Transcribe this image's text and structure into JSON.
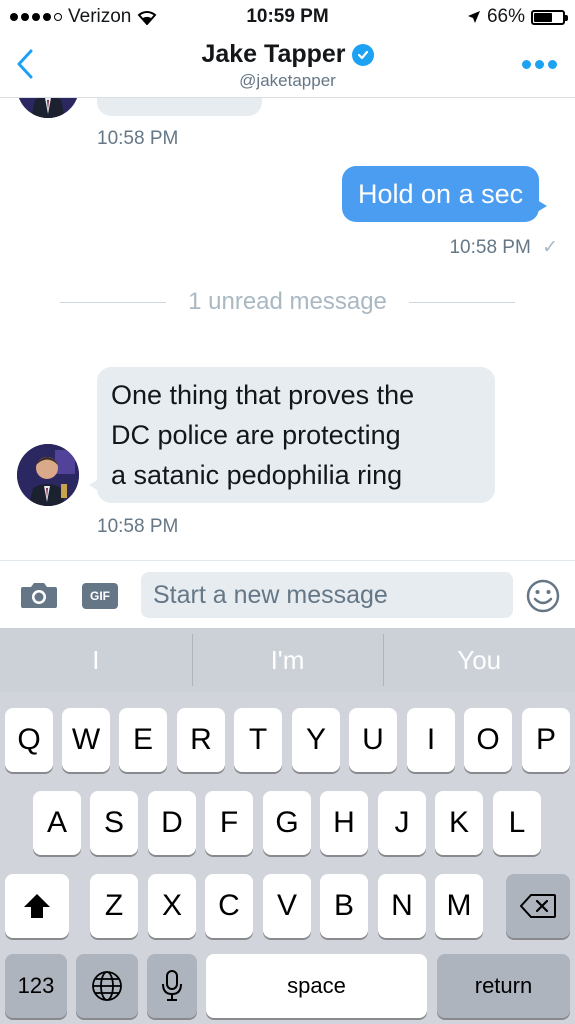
{
  "status_bar": {
    "carrier": "Verizon",
    "time": "10:59 PM",
    "battery": "66%",
    "battery_level": 0.66
  },
  "header": {
    "name": "Jake Tapper",
    "handle": "@jaketapper"
  },
  "conversation": {
    "first_time": "10:58 PM",
    "outgoing_text": "Hold on a sec",
    "outgoing_time": "10:58 PM",
    "read_mark": "✓",
    "unread_label": "1 unread message",
    "incoming_lines": [
      "One thing that proves the",
      "DC police are protecting",
      "a satanic pedophilia ring"
    ],
    "incoming_time": "10:58 PM"
  },
  "composer": {
    "gif_label": "GIF",
    "placeholder": "Start a new message"
  },
  "predictive": [
    "I",
    "I'm",
    "You"
  ],
  "keyboard": {
    "row1": [
      "Q",
      "W",
      "E",
      "R",
      "T",
      "Y",
      "U",
      "I",
      "O",
      "P"
    ],
    "row2": [
      "A",
      "S",
      "D",
      "F",
      "G",
      "H",
      "J",
      "K",
      "L"
    ],
    "row3": [
      "Z",
      "X",
      "C",
      "V",
      "B",
      "N",
      "M"
    ],
    "numbers_label": "123",
    "space_label": "space",
    "return_label": "return"
  },
  "colors": {
    "accent": "#1da1f2",
    "outgoing_bubble": "#4a9df1",
    "incoming_bubble": "#e6ecf0"
  }
}
